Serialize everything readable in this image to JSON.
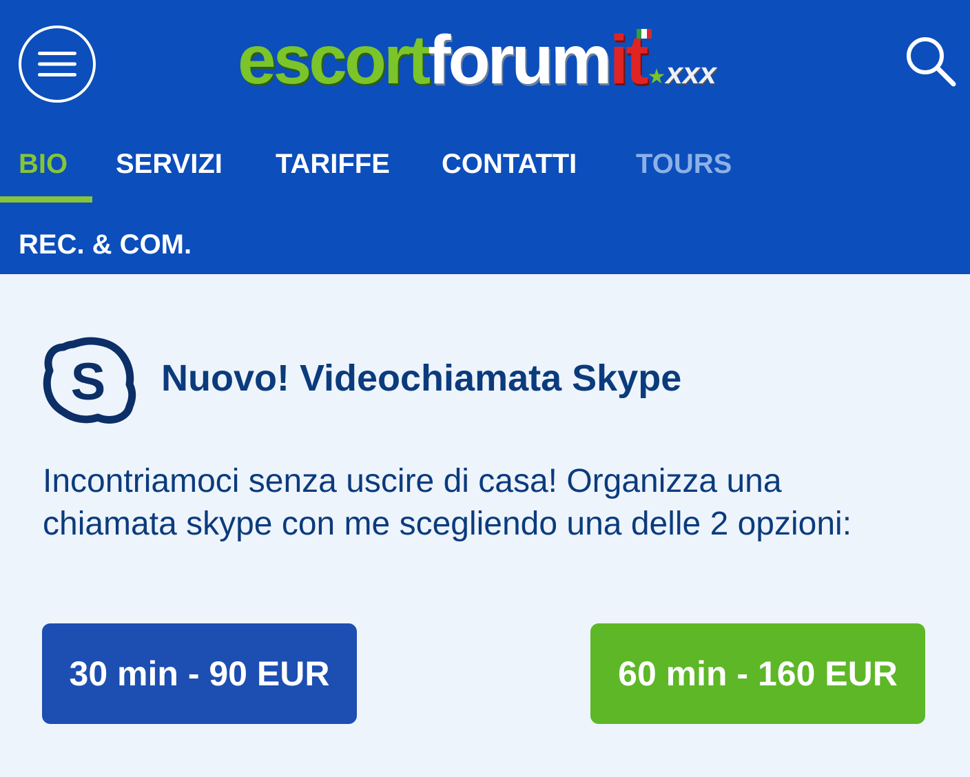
{
  "header": {
    "menu_icon": "hamburger-menu-icon",
    "search_icon": "search-icon",
    "logo": {
      "part1": "escort",
      "part2": "forum",
      "part3": "it",
      "part4": "xxx",
      "colors": {
        "green": "#7bc42a",
        "white": "#ffffff",
        "red": "#e02424"
      }
    },
    "background": "#0c4ebb"
  },
  "tabs": {
    "items": [
      {
        "label": "BIO",
        "state": "active"
      },
      {
        "label": "SERVIZI",
        "state": "normal"
      },
      {
        "label": "TARIFFE",
        "state": "normal"
      },
      {
        "label": "CONTATTI",
        "state": "normal"
      },
      {
        "label": "TOURS",
        "state": "disabled"
      },
      {
        "label": "REC. & COM.",
        "state": "normal"
      }
    ],
    "active_color": "#86c43a"
  },
  "skype": {
    "icon": "skype-icon",
    "title": "Nuovo! Videochiamata Skype",
    "description": "Incontriamoci senza uscire di casa! Organizza una chiamata skype con me scegliendo una delle 2 opzioni:",
    "options": [
      {
        "label": "30 min - 90 EUR",
        "color": "#1d4eb1"
      },
      {
        "label": "60 min - 160 EUR",
        "color": "#5db726"
      }
    ]
  }
}
